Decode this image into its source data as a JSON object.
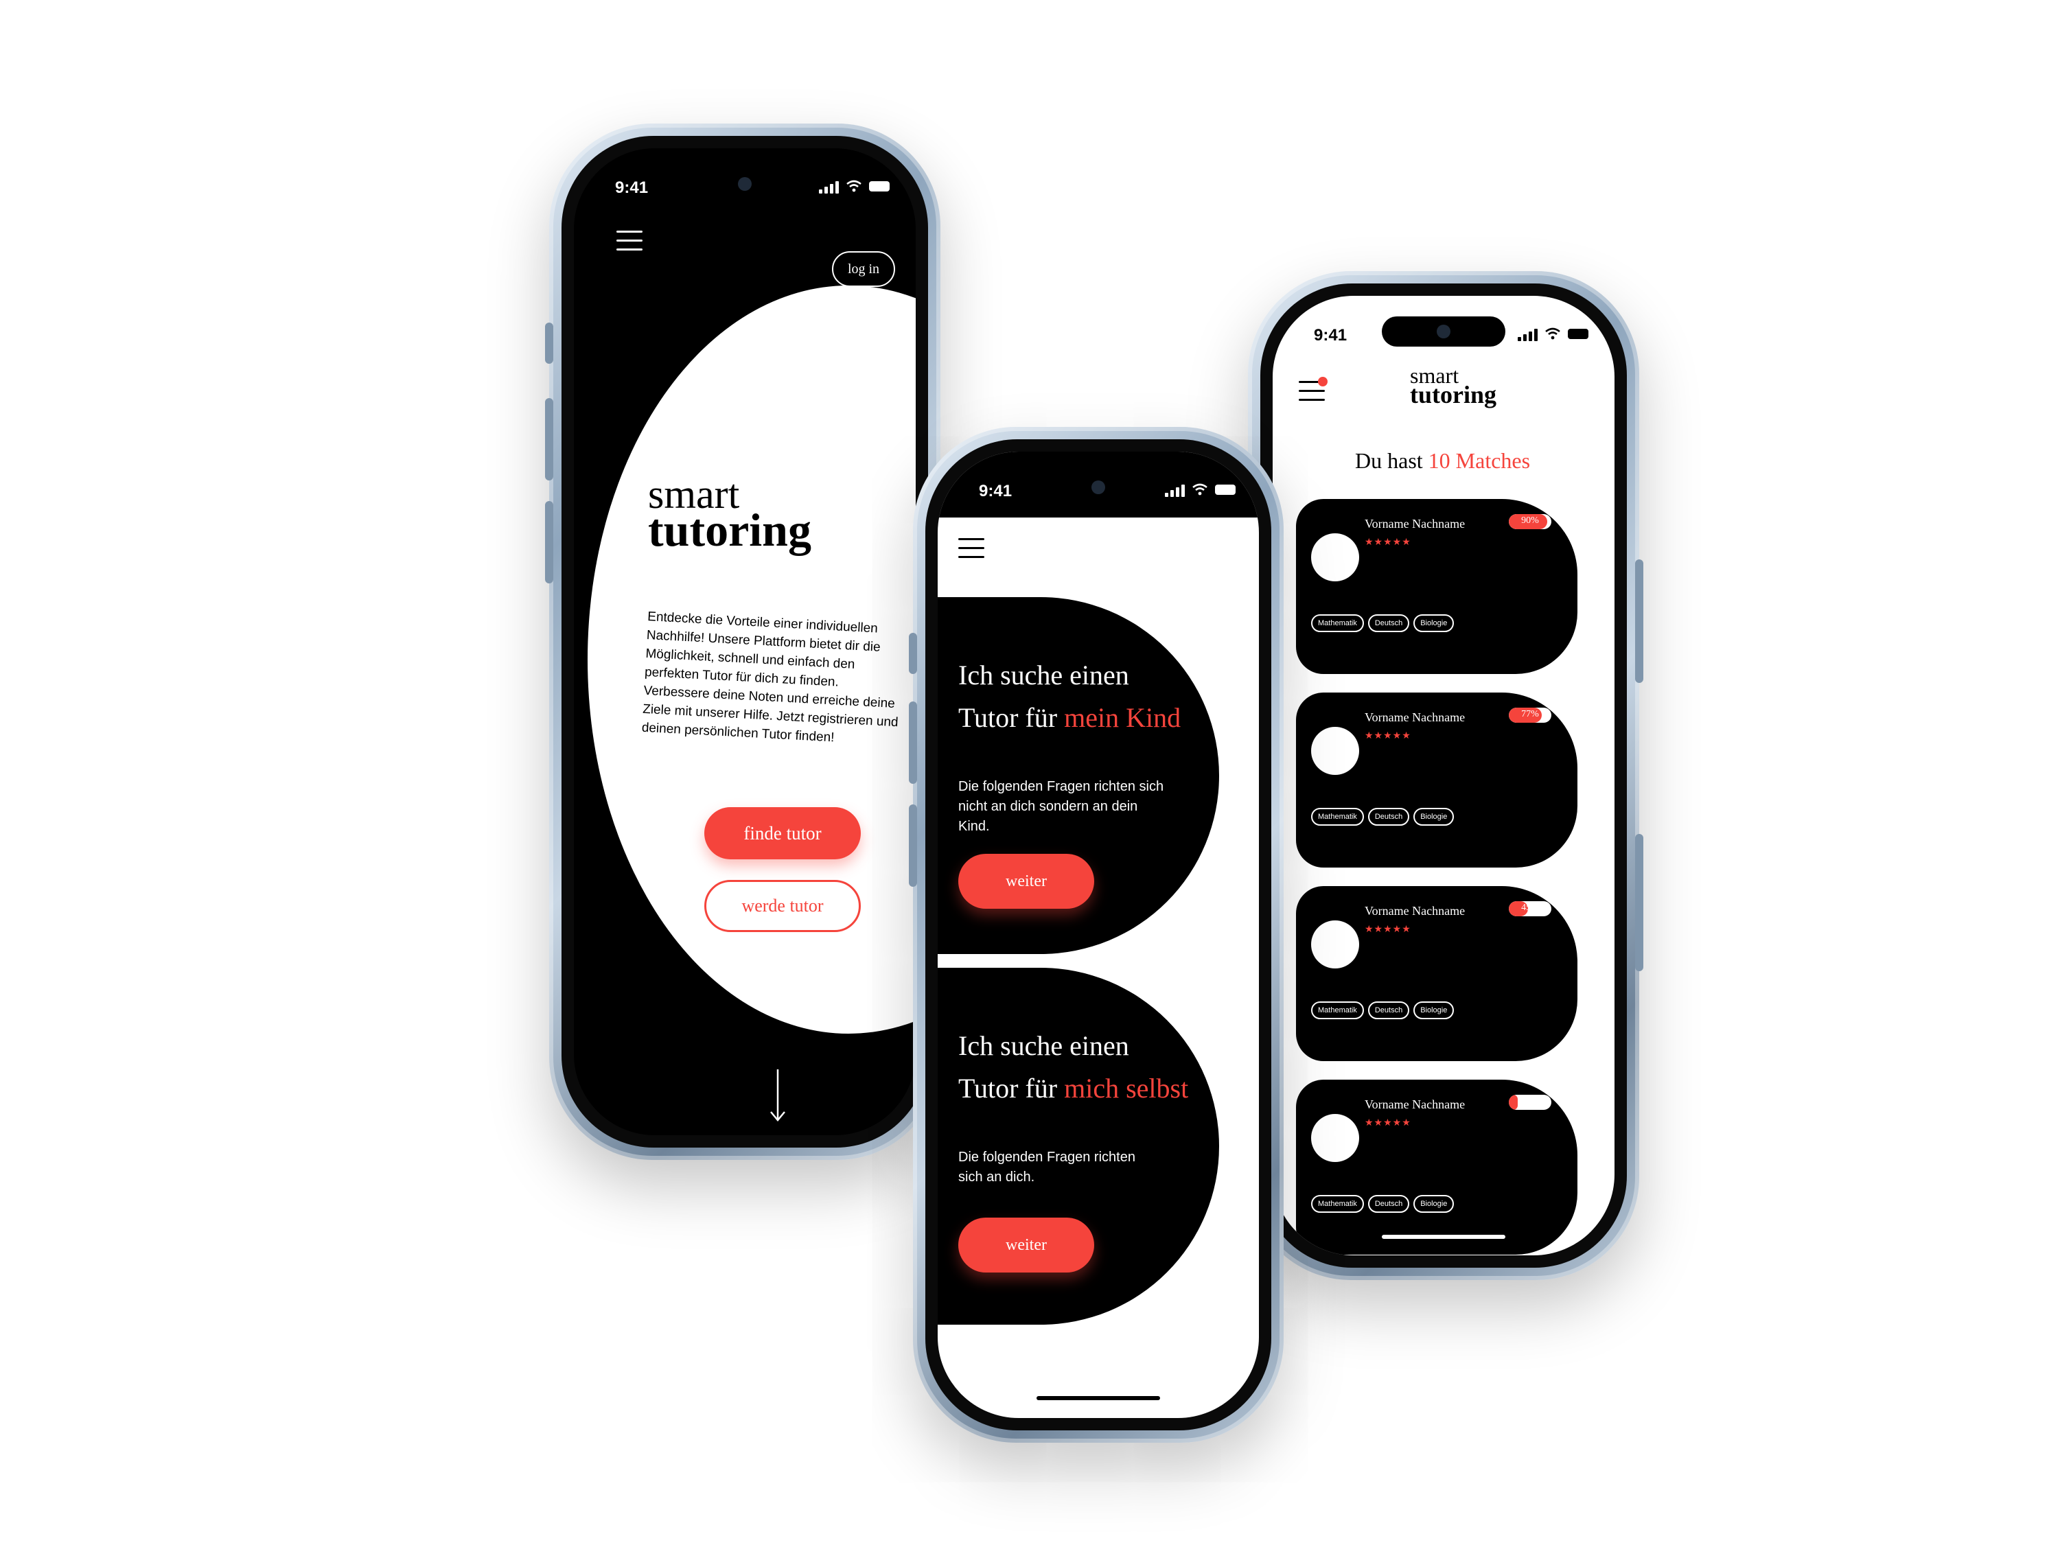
{
  "status_time": "9:41",
  "colors": {
    "accent": "#f5443c",
    "dark": "#000000",
    "light": "#ffffff"
  },
  "icons": [
    "menu-icon",
    "signal-icon",
    "wifi-icon",
    "battery-icon",
    "arrow-down-icon",
    "notification-dot-icon"
  ],
  "landing": {
    "login_label": "log in",
    "logo_line1": "smart",
    "logo_line2": "tutoring",
    "intro": "Entdecke die Vorteile einer individuellen Nachhilfe! Unsere Plattform bietet dir die Möglichkeit, schnell und einfach den perfekten Tutor für dich zu finden. Verbessere deine Noten und erreiche deine Ziele mit unserer Hilfe. Jetzt registrieren und deinen persönlichen Tutor finden!",
    "find_label": "finde tutor",
    "become_label": "werde tutor"
  },
  "choice": {
    "options": [
      {
        "line1": "Ich suche einen",
        "line2_prefix": "Tutor für ",
        "line2_accent": "mein Kind",
        "body": "Die folgenden Fragen richten sich nicht an dich sondern an dein Kind.",
        "button": "weiter"
      },
      {
        "line1": "Ich suche einen",
        "line2_prefix": "Tutor für ",
        "line2_accent": "mich selbst",
        "body": "Die folgenden Fragen richten sich an dich.",
        "button": "weiter"
      }
    ]
  },
  "matches": {
    "logo_line1": "smart",
    "logo_line2": "tutoring",
    "heading_prefix": "Du hast ",
    "heading_accent": "10 Matches",
    "cards": [
      {
        "name": "Vorname Nachname",
        "stars": "★★★★★",
        "percent": "90%",
        "fill": 0.9,
        "tags": [
          "Mathematik",
          "Deutsch",
          "Biologie"
        ]
      },
      {
        "name": "Vorname Nachname",
        "stars": "★★★★★",
        "percent": "77%",
        "fill": 0.77,
        "tags": [
          "Mathematik",
          "Deutsch",
          "Biologie"
        ]
      },
      {
        "name": "Vorname Nachname",
        "stars": "★★★★★",
        "percent": "45%",
        "fill": 0.45,
        "tags": [
          "Mathematik",
          "Deutsch",
          "Biologie"
        ]
      },
      {
        "name": "Vorname Nachname",
        "stars": "★★★★★",
        "percent": "21%",
        "fill": 0.21,
        "tags": [
          "Mathematik",
          "Deutsch",
          "Biologie"
        ]
      }
    ]
  }
}
